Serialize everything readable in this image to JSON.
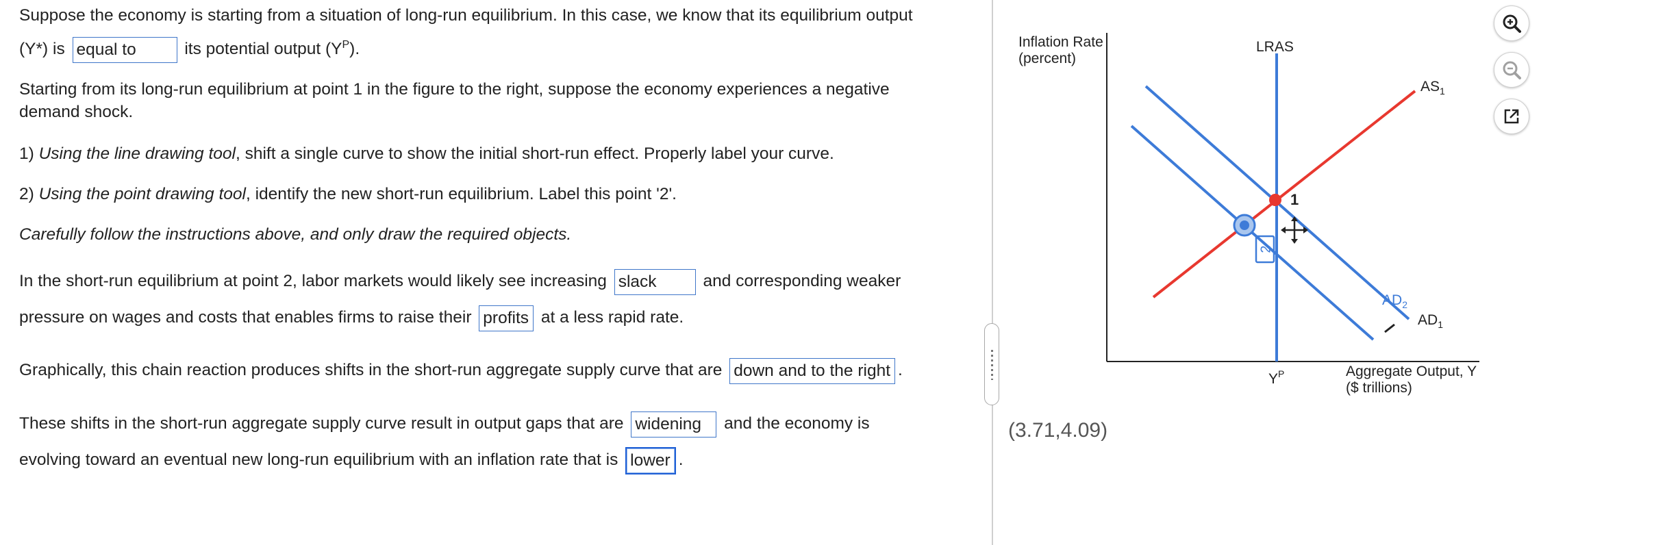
{
  "question": {
    "p1_line1": "Suppose the economy is starting from a situation of long-run equilibrium. In this case, we know that its equilibrium output",
    "p1_pre": "(Y*) is",
    "p1_ans": "equal to",
    "p1_post": "its potential output (Y",
    "p1_sup": "P",
    "p1_end": ").",
    "p2_line1": "Starting from its long-run equilibrium at point 1 in the figure  to the right, suppose the economy experiences a negative",
    "p2_line2": "demand shock.",
    "step1_num": "1) ",
    "step1_italic": "Using the line drawing tool",
    "step1_rest": ", shift a single curve to show the initial short-run effect. Properly label your curve.",
    "step2_num": "2) ",
    "step2_italic": "Using the point drawing tool",
    "step2_rest": ", identify the new short-run equilibrium. Label this point '2'.",
    "caution": "Carefully follow the instructions above, and only draw the required objects.",
    "p3_pre": "In the short-run equilibrium at point 2, labor markets would likely see increasing",
    "p3_ans1": "slack",
    "p3_mid": "and corresponding weaker",
    "p3_line2_pre": "pressure on wages and costs that enables firms to raise their",
    "p3_ans2": "profits",
    "p3_line2_post": "at a less rapid rate.",
    "p4_pre": "Graphically, this chain reaction produces shifts in the short-run aggregate supply curve that are",
    "p4_ans": "down and to the right",
    "p4_post": ".",
    "p5_pre": "These shifts in the short-run aggregate supply curve result in output gaps that are",
    "p5_ans1": "widening",
    "p5_mid": "and the economy is",
    "p5_line2_pre": "evolving toward an eventual new long-run equilibrium with an inflation rate that is",
    "p5_ans2": "lower",
    "p5_end": "."
  },
  "graph": {
    "y_axis_label_1": "Inflation Rate",
    "y_axis_label_2": "(percent)",
    "x_axis_label_1": "Aggregate Output, Y",
    "x_axis_label_2": "($ trillions)",
    "lras_label": "LRAS",
    "yp_label": "Y",
    "yp_sup": "P",
    "as1_label": "AS",
    "as1_sub": "1",
    "ad1_label": "AD",
    "ad1_sub": "1",
    "ad2_label": "AD",
    "ad2_sub": "2",
    "point1_label": "1",
    "point2_label": "2",
    "coords": "(3.71,4.09)",
    "colors": {
      "blue": "#3d7bd8",
      "red": "#e8382f",
      "axis": "#222222"
    }
  },
  "toolbar": {
    "zoom_in_icon": "zoom-in-icon",
    "zoom_out_icon": "zoom-out-icon",
    "popout_icon": "popout-icon"
  }
}
